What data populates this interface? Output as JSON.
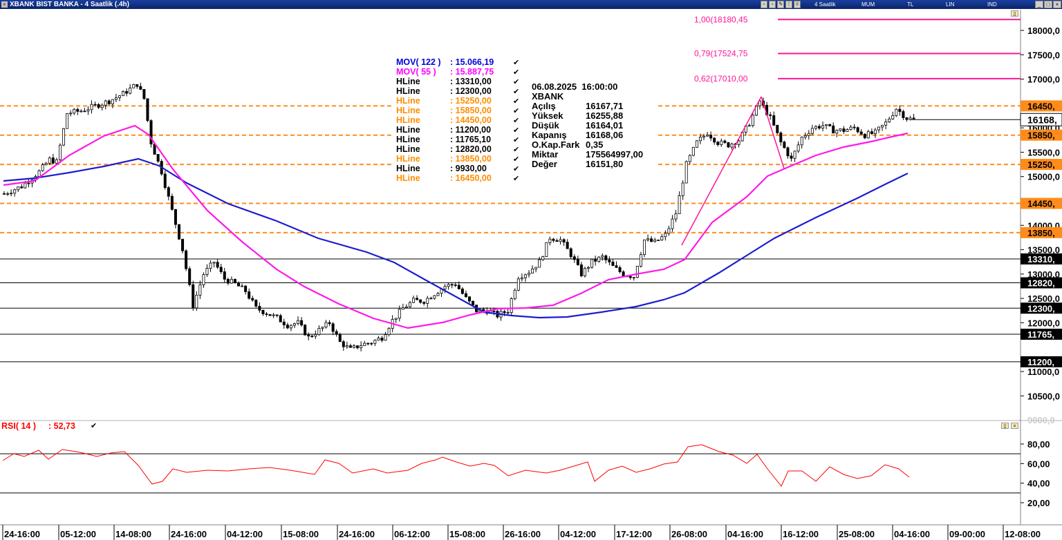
{
  "window": {
    "title": "XBANK BIST BANKA - 4 Saatlik (.4h)",
    "toolbar_labels": [
      "4 Saatlik",
      "MUM",
      "TL",
      "LIN",
      "IND"
    ]
  },
  "legend": [
    {
      "name": "MOV( 122 )",
      "value": ": 15.066,19",
      "color": "#0000dd"
    },
    {
      "name": "MOV( 55 )",
      "value": ": 15.887,75",
      "color": "#ff00ff"
    },
    {
      "name": "HLine",
      "value": ": 13310,00",
      "color": "#000000"
    },
    {
      "name": "HLine",
      "value": ": 12300,00",
      "color": "#000000"
    },
    {
      "name": "HLine",
      "value": ": 15250,00",
      "color": "#ff8c00"
    },
    {
      "name": "HLine",
      "value": ": 15850,00",
      "color": "#ff8c00"
    },
    {
      "name": "HLine",
      "value": ": 14450,00",
      "color": "#ff8c00"
    },
    {
      "name": "HLine",
      "value": ": 11200,00",
      "color": "#000000"
    },
    {
      "name": "HLine",
      "value": ": 11765,10",
      "color": "#000000"
    },
    {
      "name": "HLine",
      "value": ": 12820,00",
      "color": "#000000"
    },
    {
      "name": "HLine",
      "value": ": 13850,00",
      "color": "#ff8c00"
    },
    {
      "name": "HLine",
      "value": ": 9930,00",
      "color": "#000000"
    },
    {
      "name": "HLine",
      "value": ": 16450,00",
      "color": "#ff8c00"
    }
  ],
  "info_panel": {
    "datetime": "06.08.2025  16:00:00",
    "symbol": "XBANK",
    "rows": [
      {
        "label": "Açılış",
        "value": "16167,71"
      },
      {
        "label": "Yüksek",
        "value": "16255,88"
      },
      {
        "label": "Düşük",
        "value": "16164,01"
      },
      {
        "label": "Kapanış",
        "value": "16168,06"
      },
      {
        "label": "O.Kap.Fark",
        "value": "0,35"
      },
      {
        "label": "Miktar",
        "value": "175564997,00"
      },
      {
        "label": "Değer",
        "value": "16151,80"
      }
    ]
  },
  "fib_labels": [
    {
      "text": "1,00(18180,45",
      "value": 18180.45
    },
    {
      "text": "0,79(17524,75",
      "value": 17524.75
    },
    {
      "text": "0,62(17010,00",
      "value": 17010
    }
  ],
  "hlines_dashed": [
    {
      "value": 16450,
      "label": "16450,"
    },
    {
      "value": 15850,
      "label": "15850,"
    },
    {
      "value": 15250,
      "label": "15250,"
    },
    {
      "value": 14450,
      "label": "14450,"
    },
    {
      "value": 13850,
      "label": "13850,"
    }
  ],
  "hlines_solid": [
    {
      "value": 13310,
      "label": "13310,"
    },
    {
      "value": 12820,
      "label": "12820,"
    },
    {
      "value": 12300,
      "label": "12300,"
    },
    {
      "value": 11765,
      "label": "11765,"
    },
    {
      "value": 11200,
      "label": "11200,"
    }
  ],
  "current_price_label": "16168,",
  "price_axis_labels": [
    "18000,0",
    "17500,0",
    "17000,0",
    "16000,0",
    "15500,0",
    "15000,0",
    "14000,0",
    "13500,0",
    "13000,0",
    "12500,0",
    "12000,0",
    "11000,0",
    "10500,0"
  ],
  "price_axis_values": [
    18000,
    17500,
    17000,
    16000,
    15500,
    15000,
    14000,
    13500,
    13000,
    12500,
    12000,
    11000,
    10500
  ],
  "time_axis_labels": [
    "24-16:00",
    "05-12:00",
    "14-08:00",
    "24-16:00",
    "04-12:00",
    "15-08:00",
    "24-16:00",
    "06-12:00",
    "15-08:00",
    "26-16:00",
    "04-12:00",
    "17-12:00",
    "26-08:00",
    "04-16:00",
    "16-12:00",
    "25-08:00",
    "04-16:00",
    "09-00:00",
    "12-08:00"
  ],
  "rsi": {
    "label": "RSI( 14 )",
    "value": ": 52,73",
    "axis_labels": [
      "80,00",
      "60,00",
      "40,00",
      "20,00"
    ],
    "axis_values": [
      80,
      60,
      40,
      20
    ],
    "levels": [
      70,
      30
    ]
  },
  "colors": {
    "mov122": "#1c1cd0",
    "mov55": "#ff18e8",
    "dashed": "#ff8c1a",
    "fib": "#ff1493",
    "rsi": "#ff0000",
    "candle": "#000000"
  },
  "chart_data": {
    "type": "candlestick",
    "title": "XBANK BIST BANKA - 4 Saatlik (.4h)",
    "ylim": [
      10000,
      18300
    ],
    "x_ticks": [
      "24-16:00",
      "05-12:00",
      "14-08:00",
      "24-16:00",
      "04-12:00",
      "15-08:00",
      "24-16:00",
      "06-12:00",
      "15-08:00",
      "26-16:00",
      "04-12:00",
      "17-12:00",
      "26-08:00",
      "04-16:00",
      "16-12:00",
      "25-08:00",
      "04-16:00",
      "09-00:00",
      "12-08:00"
    ],
    "close_path_approx": [
      [
        0,
        14650
      ],
      [
        5,
        14800
      ],
      [
        10,
        15100
      ],
      [
        13,
        15350
      ],
      [
        15,
        15300
      ],
      [
        18,
        16300
      ],
      [
        22,
        16350
      ],
      [
        26,
        16450
      ],
      [
        30,
        16550
      ],
      [
        34,
        16700
      ],
      [
        38,
        16900
      ],
      [
        40,
        16600
      ],
      [
        42,
        15700
      ],
      [
        45,
        15100
      ],
      [
        48,
        14300
      ],
      [
        51,
        13500
      ],
      [
        54,
        12350
      ],
      [
        57,
        13000
      ],
      [
        60,
        13250
      ],
      [
        63,
        12900
      ],
      [
        66,
        12800
      ],
      [
        69,
        12650
      ],
      [
        72,
        12300
      ],
      [
        75,
        12200
      ],
      [
        78,
        12100
      ],
      [
        81,
        11950
      ],
      [
        84,
        12000
      ],
      [
        87,
        11700
      ],
      [
        90,
        11850
      ],
      [
        93,
        12000
      ],
      [
        96,
        11600
      ],
      [
        99,
        11450
      ],
      [
        102,
        11550
      ],
      [
        105,
        11600
      ],
      [
        108,
        11700
      ],
      [
        111,
        12050
      ],
      [
        114,
        12300
      ],
      [
        117,
        12450
      ],
      [
        120,
        12450
      ],
      [
        123,
        12600
      ],
      [
        126,
        12750
      ],
      [
        129,
        12800
      ],
      [
        132,
        12500
      ],
      [
        135,
        12250
      ],
      [
        138,
        12250
      ],
      [
        141,
        12150
      ],
      [
        144,
        12250
      ],
      [
        147,
        12950
      ],
      [
        150,
        13050
      ],
      [
        153,
        13250
      ],
      [
        156,
        13750
      ],
      [
        159,
        13700
      ],
      [
        162,
        13400
      ],
      [
        165,
        13000
      ],
      [
        168,
        13250
      ],
      [
        171,
        13350
      ],
      [
        174,
        13150
      ],
      [
        177,
        13000
      ],
      [
        180,
        12950
      ],
      [
        183,
        13700
      ],
      [
        186,
        13650
      ],
      [
        189,
        13800
      ],
      [
        192,
        14250
      ],
      [
        195,
        15250
      ],
      [
        198,
        15700
      ],
      [
        201,
        15900
      ],
      [
        204,
        15700
      ],
      [
        207,
        15650
      ],
      [
        210,
        15750
      ],
      [
        213,
        16100
      ],
      [
        216,
        16550
      ],
      [
        219,
        16200
      ],
      [
        222,
        15700
      ],
      [
        225,
        15350
      ],
      [
        228,
        15800
      ],
      [
        231,
        16000
      ],
      [
        234,
        16050
      ],
      [
        237,
        15950
      ],
      [
        240,
        15950
      ],
      [
        243,
        16000
      ],
      [
        246,
        15850
      ],
      [
        249,
        15900
      ],
      [
        252,
        16100
      ],
      [
        255,
        16400
      ],
      [
        258,
        16200
      ],
      [
        260,
        16168
      ]
    ],
    "series": [
      {
        "name": "MOV( 122 )",
        "last": 15066.19
      },
      {
        "name": "MOV( 55 )",
        "last": 15887.75
      }
    ],
    "ylabel": "",
    "xlabel": ""
  }
}
